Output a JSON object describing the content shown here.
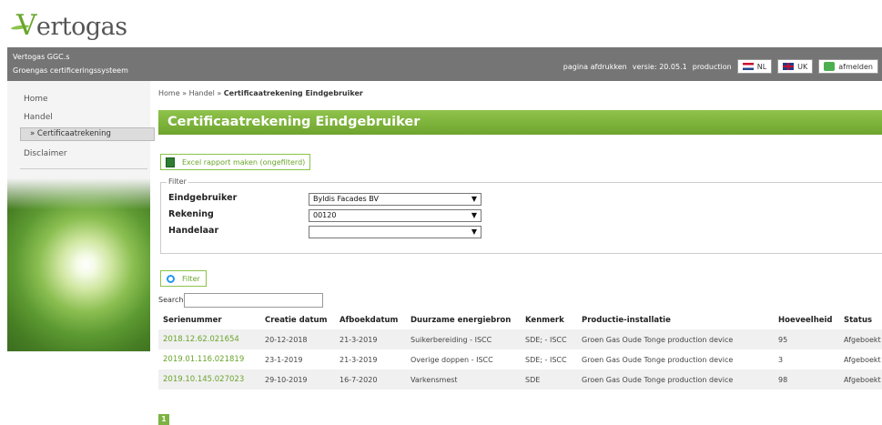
{
  "logo": {
    "text_v": "V",
    "text_rest": "ertogas"
  },
  "topbar": {
    "system_name": "Vertogas GGC.s",
    "system_subtitle": "Groengas certificeringssysteem",
    "print_link": "pagina afdrukken",
    "version": "versie: 20.05.1",
    "environment": "production",
    "lang_nl": "NL",
    "lang_uk": "UK",
    "logout": "afmelden"
  },
  "sidebar": {
    "items": [
      {
        "label": "Home"
      },
      {
        "label": "Handel"
      },
      {
        "label": "» Certificaatrekening"
      },
      {
        "label": "Disclaimer"
      }
    ]
  },
  "breadcrumb": {
    "part1": "Home » Handel » ",
    "current": "Certificaatrekening Eindgebruiker"
  },
  "page_title": "Certificaatrekening Eindgebruiker",
  "excel_button": "Excel rapport maken (ongefilterd)",
  "filter": {
    "legend": "Filter",
    "fields": [
      {
        "label": "Eindgebruiker",
        "value": "Byldis Facades BV"
      },
      {
        "label": "Rekening",
        "value": "00120"
      },
      {
        "label": "Handelaar",
        "value": ""
      }
    ],
    "button": "Filter"
  },
  "search": {
    "label": "Search:",
    "value": ""
  },
  "table": {
    "headers": [
      "Serienummer",
      "Creatie datum",
      "Afboekdatum",
      "Duurzame energiebron",
      "Kenmerk",
      "Productie-installatie",
      "Hoeveelheid",
      "Status"
    ],
    "rows": [
      [
        "2018.12.62.021654",
        "20-12-2018",
        "21-3-2019",
        "Suikerbereiding - ISCC",
        "SDE; - ISCC",
        "Groen Gas Oude Tonge production device",
        "95",
        "Afgeboekt"
      ],
      [
        "2019.01.116.021819",
        "23-1-2019",
        "21-3-2019",
        "Overige doppen - ISCC",
        "SDE; - ISCC",
        "Groen Gas Oude Tonge production device",
        "3",
        "Afgeboekt"
      ],
      [
        "2019.10.145.027023",
        "29-10-2019",
        "16-7-2020",
        "Varkensmest",
        "SDE",
        "Groen Gas Oude Tonge production device",
        "98",
        "Afgeboekt"
      ]
    ]
  },
  "pager": {
    "current": "1"
  },
  "colors": {
    "accent": "#7cb342",
    "topbar": "#757575",
    "link": "#6aa52c"
  }
}
